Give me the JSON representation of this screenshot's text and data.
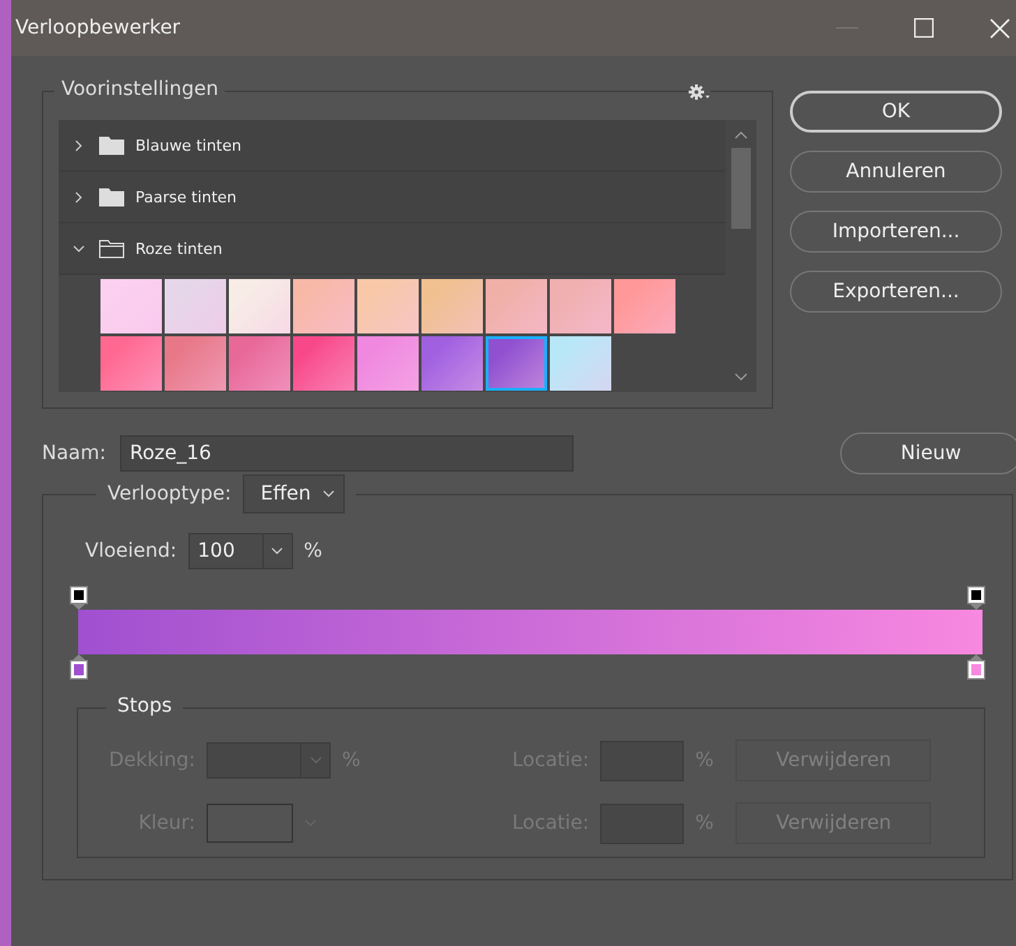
{
  "window": {
    "title": "Verloopbewerker"
  },
  "presets": {
    "title": "Voorinstellingen",
    "folders": [
      {
        "label": "Blauwe tinten",
        "expanded": false
      },
      {
        "label": "Paarse tinten",
        "expanded": false
      },
      {
        "label": "Roze tinten",
        "expanded": true
      }
    ],
    "swatches": [
      {
        "color": "#fbd0f0",
        "selected": false
      },
      {
        "color": "#e6d6ea",
        "selected": false
      },
      {
        "color": "#f7ede6",
        "selected": false
      },
      {
        "color": "#f8b8a8",
        "selected": false
      },
      {
        "color": "#f8c8a8",
        "selected": false
      },
      {
        "color": "#f0c090",
        "selected": false
      },
      {
        "color": "#f0b0a8",
        "selected": false
      },
      {
        "color": "#f0b0b0",
        "selected": false
      },
      {
        "color": "#ff9898",
        "selected": false
      },
      {
        "color": "#ff6890",
        "selected": false
      },
      {
        "color": "#e87888",
        "selected": false
      },
      {
        "color": "#e86898",
        "selected": false
      },
      {
        "color": "#f8488a",
        "selected": false
      },
      {
        "color": "#f088e0",
        "selected": false
      },
      {
        "color": "#a060e0",
        "selected": false
      },
      {
        "color": "#9050d0",
        "selected": true
      },
      {
        "color": "#b8e8f8",
        "selected": false
      }
    ]
  },
  "buttons": [
    "OK",
    "Annuleren",
    "Importeren...",
    "Exporteren..."
  ],
  "name": {
    "label": "Naam:",
    "value": "Roze_16",
    "button": "Nieuw"
  },
  "gradient": {
    "type_label": "Verlooptype:",
    "type_value": "Effen",
    "smooth_label": "Vloeiend:",
    "smooth_value": "100",
    "smooth_unit": "%",
    "opacity_stops": [
      {
        "color": "#000000"
      },
      {
        "color": "#000000"
      }
    ],
    "color_stops": [
      {
        "color": "#a050d0"
      },
      {
        "color": "#f888e0"
      }
    ]
  },
  "stops": {
    "title": "Stops",
    "disabled": true,
    "opacity_label": "Dekking:",
    "opacity_unit": "%",
    "color_label": "Kleur:",
    "rows": [
      {
        "location_label": "Locatie:",
        "unit": "%",
        "button": "Verwijderen"
      },
      {
        "location_label": "Locatie:",
        "unit": "%",
        "button": "Verwijderen"
      }
    ]
  }
}
